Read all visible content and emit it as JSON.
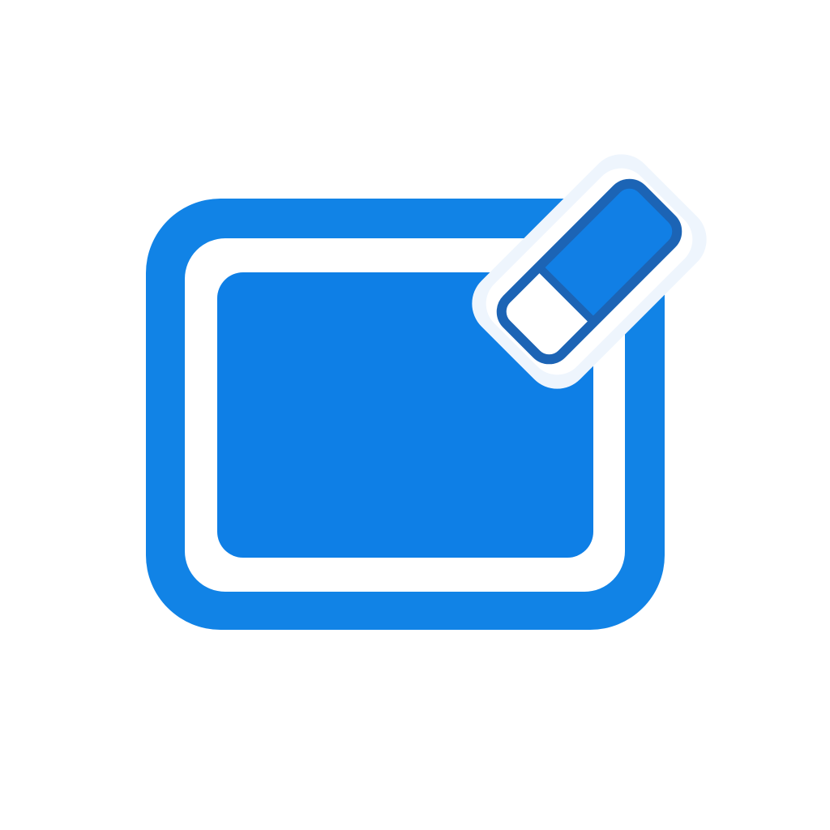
{
  "icon": {
    "name": "clear-canvas-icon",
    "parts": [
      "board-frame",
      "board-fill",
      "eraser"
    ]
  },
  "colors": {
    "background": "#ffffff",
    "frame_blue": "#1183E6",
    "fill_blue": "#0E7FE6",
    "eraser_blue": "#117FE5",
    "eraser_outline": "#1C64B5",
    "eraser_tip": "#ffffff",
    "halo": "#EEF5FD"
  }
}
